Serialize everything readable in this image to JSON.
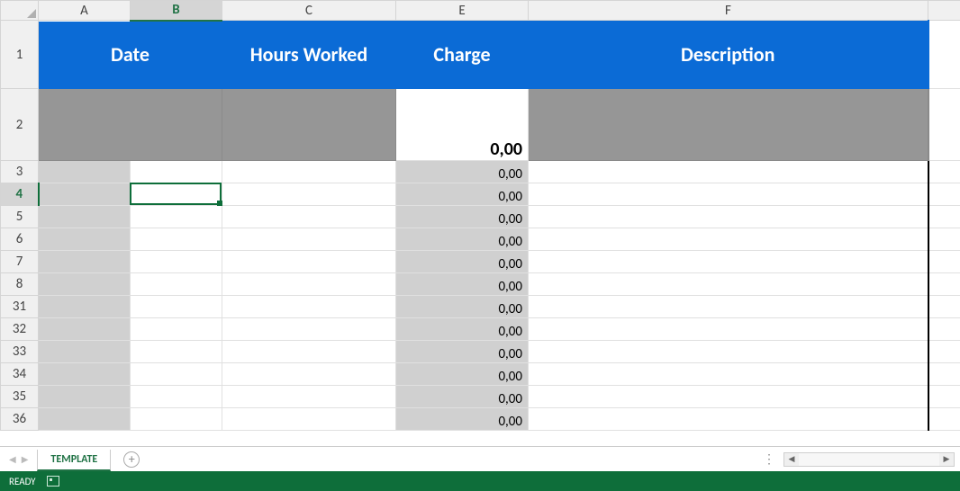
{
  "columns": [
    "A",
    "B",
    "C",
    "E",
    "F"
  ],
  "row_numbers": [
    "1",
    "2",
    "3",
    "4",
    "5",
    "6",
    "7",
    "8",
    "31",
    "32",
    "33",
    "34",
    "35",
    "36"
  ],
  "active_cell": {
    "col": "B",
    "row": "4"
  },
  "headers": {
    "date": "Date",
    "hours": "Hours Worked",
    "charge": "Charge",
    "description": "Description"
  },
  "total_row": {
    "charge": "0,00"
  },
  "data_rows": [
    {
      "charge": "0,00"
    },
    {
      "charge": "0,00"
    },
    {
      "charge": "0,00"
    },
    {
      "charge": "0,00"
    },
    {
      "charge": "0,00"
    },
    {
      "charge": "0,00"
    },
    {
      "charge": "0,00"
    },
    {
      "charge": "0,00"
    },
    {
      "charge": "0,00"
    },
    {
      "charge": "0,00"
    },
    {
      "charge": "0,00"
    },
    {
      "charge": "0,00"
    }
  ],
  "sheet_tab": "TEMPLATE",
  "status": "READY"
}
